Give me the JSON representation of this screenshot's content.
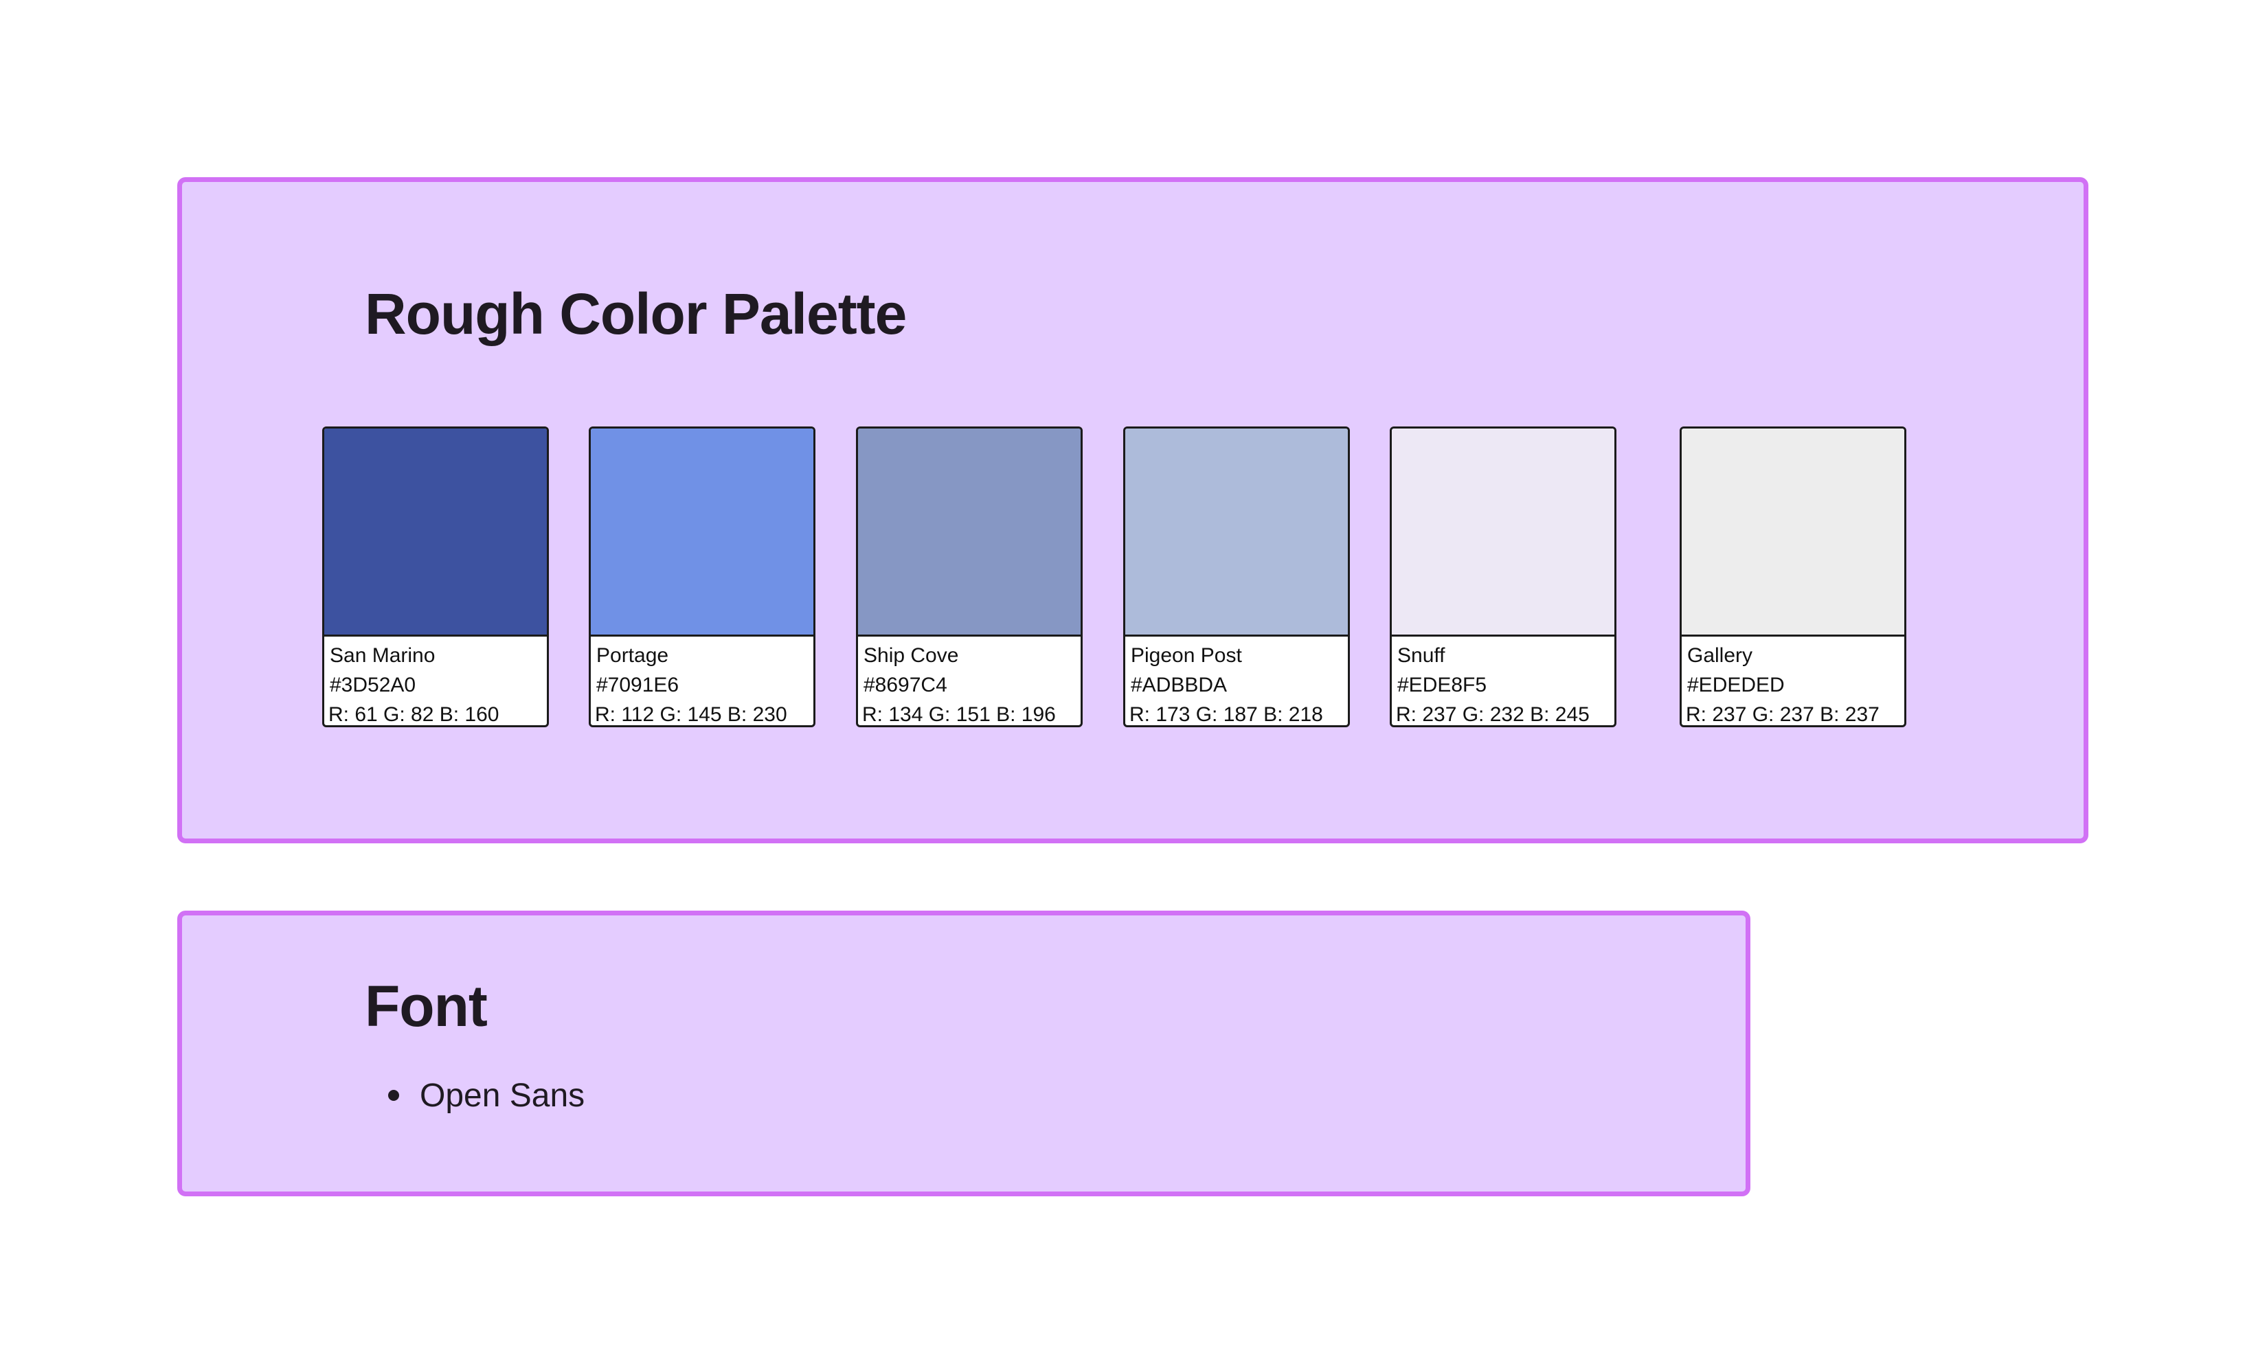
{
  "palette_section": {
    "title": "Rough Color Palette",
    "swatches": [
      {
        "name": "San Marino",
        "hex": "#3D52A0",
        "rgb": "R: 61 G: 82 B: 160",
        "color": "#3D52A0"
      },
      {
        "name": "Portage",
        "hex": "#7091E6",
        "rgb": "R: 112 G: 145 B: 230",
        "color": "#7091E6"
      },
      {
        "name": "Ship Cove",
        "hex": "#8697C4",
        "rgb": "R: 134 G: 151 B: 196",
        "color": "#8697C4"
      },
      {
        "name": "Pigeon Post",
        "hex": "#ADBBDA",
        "rgb": "R: 173 G: 187 B: 218",
        "color": "#ADBBDA"
      },
      {
        "name": "Snuff",
        "hex": "#EDE8F5",
        "rgb": "R: 237 G: 232 B: 245",
        "color": "#EDE8F5"
      },
      {
        "name": "Gallery",
        "hex": "#EDEDED",
        "rgb": "R: 237 G: 237 B: 237",
        "color": "#EDEDED"
      }
    ]
  },
  "font_section": {
    "title": "Font",
    "items": [
      "Open Sans"
    ]
  },
  "colors": {
    "frame_fill": "#E4CCFF",
    "frame_border": "#D171F5",
    "text": "#1f1a22"
  }
}
